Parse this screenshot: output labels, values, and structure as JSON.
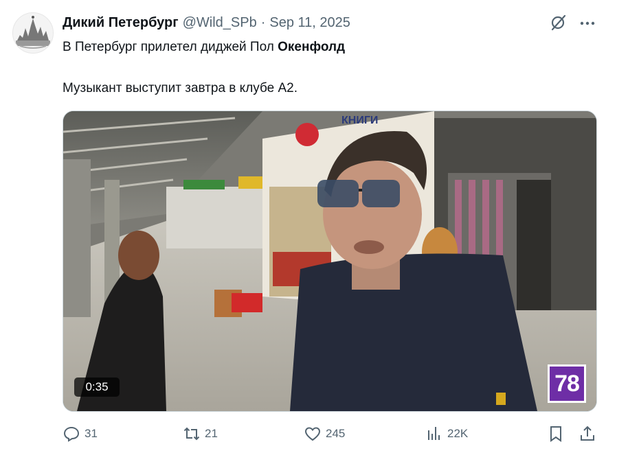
{
  "tweet": {
    "author": {
      "display_name": "Дикий Петербург",
      "handle": "@Wild_SPb",
      "separator": "·",
      "date": "Sep 11, 2025"
    },
    "text_line1_prefix": "В Петербург прилетел диджей Пол ",
    "text_line1_bold": "Окенфолд",
    "text_line2": "Музыкант выступит завтра в клубе А2.",
    "media": {
      "duration": "0:35",
      "channel_logo": "78",
      "store_sign": "КНИГИ"
    },
    "actions": {
      "reply_count": "31",
      "repost_count": "21",
      "like_count": "245",
      "view_count": "22K"
    },
    "icons": [
      "grok-icon",
      "more-icon",
      "reply-icon",
      "repost-icon",
      "like-icon",
      "views-icon",
      "bookmark-icon",
      "share-icon"
    ],
    "colors": {
      "text": "#0f1419",
      "secondary": "#536471",
      "channel_logo": "#6e2ea6"
    }
  }
}
